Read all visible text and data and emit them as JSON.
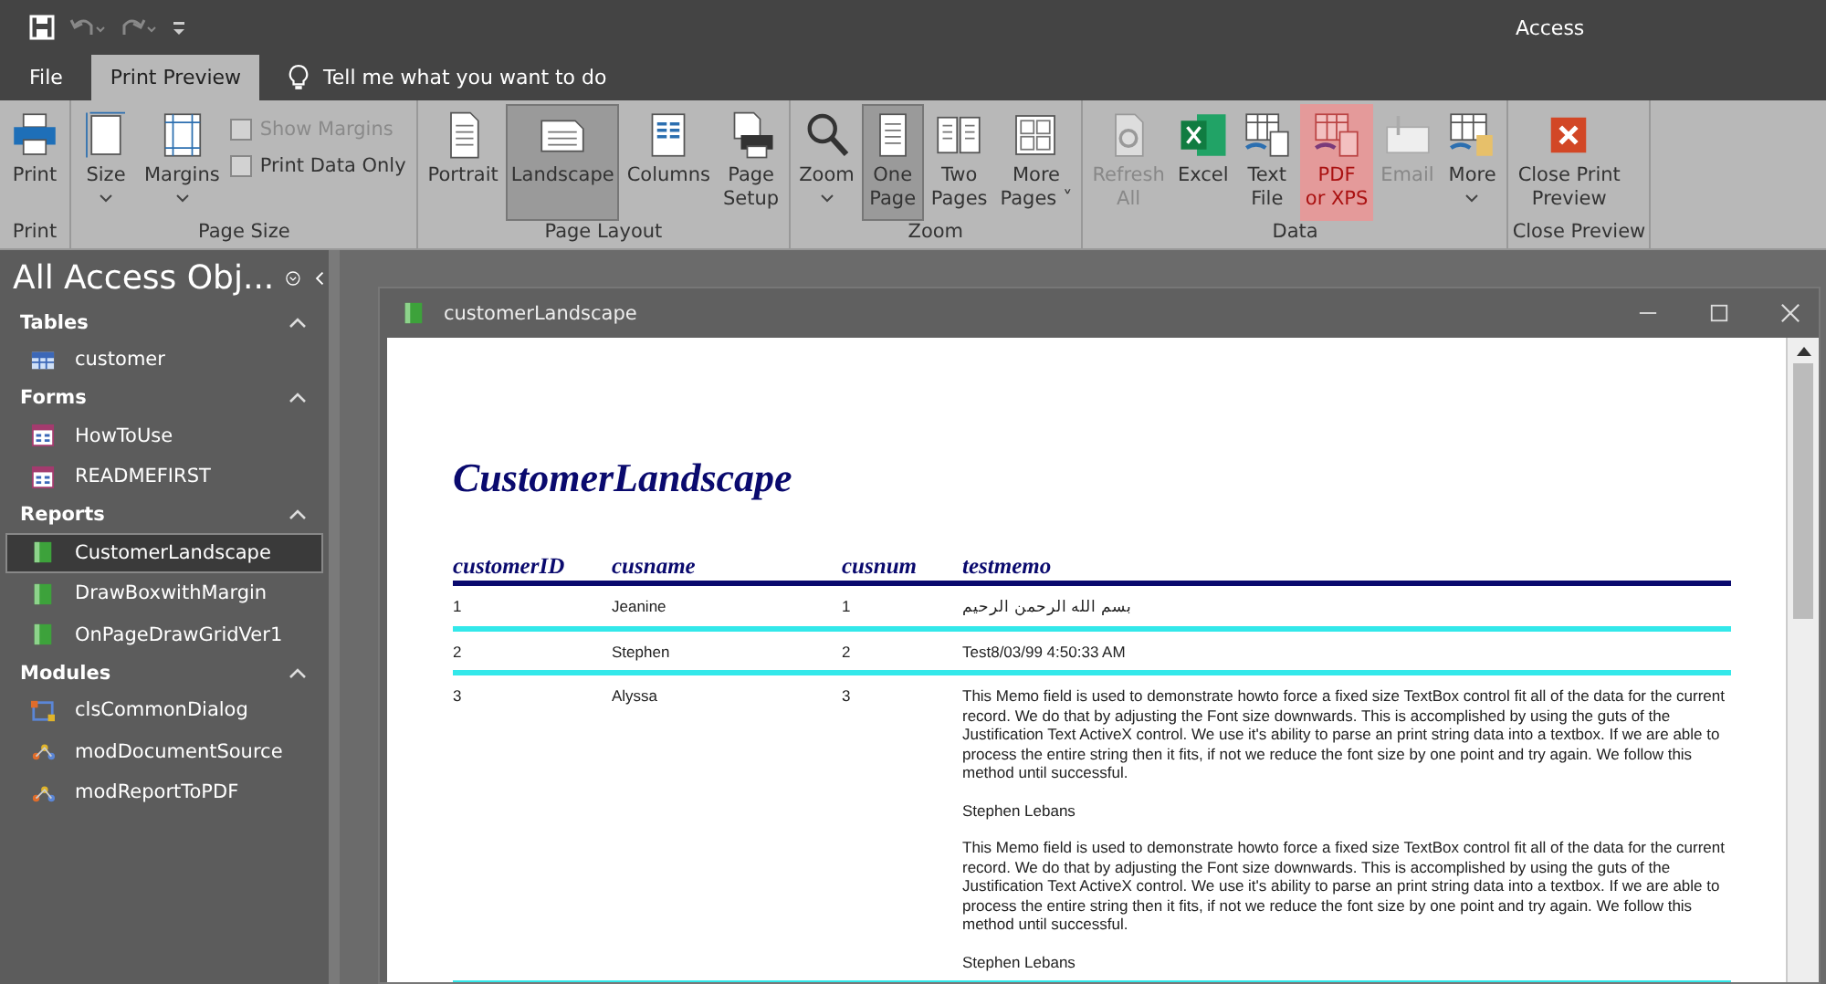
{
  "app_title": "Access",
  "ribbon_tabs": [
    {
      "label": "File",
      "selected": false
    },
    {
      "label": "Print Preview",
      "selected": true
    }
  ],
  "tell_me": "Tell me what you want to do",
  "ribbon_groups": [
    {
      "label": "Print",
      "items": [
        {
          "kind": "button",
          "label": "Print",
          "selected": false,
          "disabled": false,
          "highlighted": false,
          "dropdown": false
        }
      ]
    },
    {
      "label": "Page Size",
      "items": [
        {
          "kind": "button",
          "label": "Size",
          "selected": false,
          "disabled": false,
          "highlighted": false,
          "dropdown": true
        },
        {
          "kind": "button",
          "label": "Margins",
          "selected": false,
          "disabled": false,
          "highlighted": false,
          "dropdown": true
        },
        {
          "kind": "checks",
          "checks": [
            {
              "label": "Show Margins",
              "checked": false,
              "disabled": true
            },
            {
              "label": "Print Data Only",
              "checked": false,
              "disabled": false
            }
          ]
        }
      ]
    },
    {
      "label": "Page Layout",
      "items": [
        {
          "kind": "button",
          "label": "Portrait",
          "selected": false,
          "disabled": false,
          "highlighted": false,
          "dropdown": false
        },
        {
          "kind": "button",
          "label": "Landscape",
          "selected": true,
          "disabled": false,
          "highlighted": false,
          "dropdown": false
        },
        {
          "kind": "button",
          "label": "Columns",
          "selected": false,
          "disabled": false,
          "highlighted": false,
          "dropdown": false
        },
        {
          "kind": "button",
          "label": "Page\nSetup",
          "selected": false,
          "disabled": false,
          "highlighted": false,
          "dropdown": false
        }
      ]
    },
    {
      "label": "Zoom",
      "items": [
        {
          "kind": "button",
          "label": "Zoom",
          "selected": false,
          "disabled": false,
          "highlighted": false,
          "dropdown": true
        },
        {
          "kind": "button",
          "label": "One\nPage",
          "selected": true,
          "disabled": false,
          "highlighted": false,
          "dropdown": false
        },
        {
          "kind": "button",
          "label": "Two\nPages",
          "selected": false,
          "disabled": false,
          "highlighted": false,
          "dropdown": false
        },
        {
          "kind": "button",
          "label": "More\nPages ˅",
          "selected": false,
          "disabled": false,
          "highlighted": false,
          "dropdown": false
        }
      ]
    },
    {
      "label": "Data",
      "items": [
        {
          "kind": "button",
          "label": "Refresh\nAll",
          "selected": false,
          "disabled": true,
          "highlighted": false,
          "dropdown": false
        },
        {
          "kind": "button",
          "label": "Excel",
          "selected": false,
          "disabled": false,
          "highlighted": false,
          "dropdown": false
        },
        {
          "kind": "button",
          "label": "Text\nFile",
          "selected": false,
          "disabled": false,
          "highlighted": false,
          "dropdown": false
        },
        {
          "kind": "button",
          "label": "PDF\nor XPS",
          "selected": false,
          "disabled": false,
          "highlighted": true,
          "dropdown": false
        },
        {
          "kind": "button",
          "label": "Email",
          "selected": false,
          "disabled": true,
          "highlighted": false,
          "dropdown": false
        },
        {
          "kind": "button",
          "label": "More",
          "selected": false,
          "disabled": false,
          "highlighted": false,
          "dropdown": true
        }
      ]
    },
    {
      "label": "Close Preview",
      "items": [
        {
          "kind": "button",
          "label": "Close Print\nPreview",
          "selected": false,
          "disabled": false,
          "highlighted": false,
          "dropdown": false
        }
      ]
    }
  ],
  "nav_pane": {
    "title": "All Access Obj...",
    "sections": [
      {
        "header": "Tables",
        "expanded": true,
        "items": [
          {
            "label": "customer",
            "kind": "table",
            "selected": false
          }
        ]
      },
      {
        "header": "Forms",
        "expanded": true,
        "items": [
          {
            "label": "HowToUse",
            "kind": "form",
            "selected": false
          },
          {
            "label": "READMEFIRST",
            "kind": "form",
            "selected": false
          }
        ]
      },
      {
        "header": "Reports",
        "expanded": true,
        "items": [
          {
            "label": "CustomerLandscape",
            "kind": "report",
            "selected": true
          },
          {
            "label": "DrawBoxwithMargin",
            "kind": "report",
            "selected": false
          },
          {
            "label": "OnPageDrawGridVer1",
            "kind": "report",
            "selected": false
          }
        ]
      },
      {
        "header": "Modules",
        "expanded": true,
        "items": [
          {
            "label": "clsCommonDialog",
            "kind": "class",
            "selected": false
          },
          {
            "label": "modDocumentSource",
            "kind": "module",
            "selected": false
          },
          {
            "label": "modReportToPDF",
            "kind": "module",
            "selected": false
          }
        ]
      }
    ]
  },
  "document_window": {
    "title": "customerLandscape"
  },
  "report": {
    "title": "CustomerLandscape",
    "columns": [
      "customerID",
      "cusname",
      "cusnum",
      "testmemo"
    ],
    "rows": [
      {
        "cells": [
          "1",
          "Jeanine",
          "1"
        ],
        "memo": [
          "بسم الله الرحمن الرحيم"
        ]
      },
      {
        "cells": [
          "2",
          "Stephen",
          "2"
        ],
        "memo": [
          "Test8/03/99 4:50:33 AM"
        ]
      },
      {
        "cells": [
          "3",
          "Alyssa",
          "3"
        ],
        "memo": [
          "This Memo field is used to demonstrate howto force a fixed size TextBox control fit all of the data for the current record. We do that by adjusting the Font size downwards. This is accomplished by using the guts of the Justification Text ActiveX control. We use it's ability to parse an print string data into a textbox. If we are able to process the entire string then it fits, if not we reduce the font size by one point and try again. We follow this method until successful.",
          "Stephen Lebans",
          "This Memo field is used to demonstrate howto force a fixed size TextBox control fit all of the data for the current record. We do that by adjusting the Font size downwards. This is accomplished by using the guts of the Justification Text ActiveX control. We use it's ability to parse an print string data into a textbox. If we are able to process the entire string then it fits, if not we reduce the font size by one point and try again. We follow this method until successful.",
          "Stephen Lebans"
        ]
      }
    ]
  }
}
